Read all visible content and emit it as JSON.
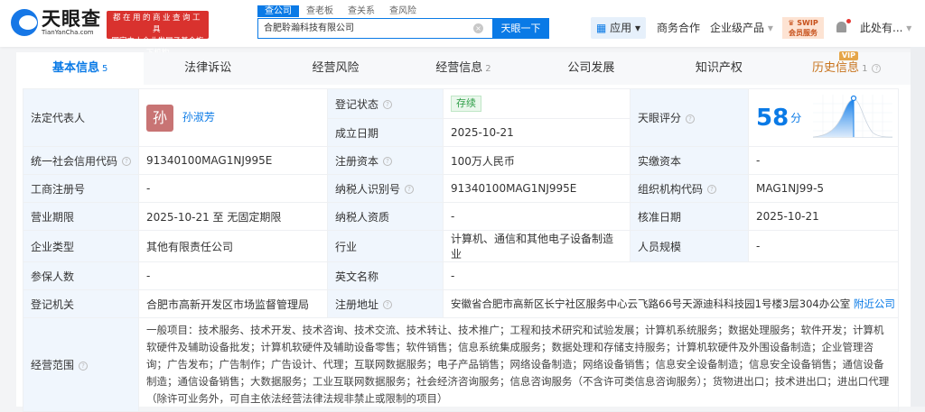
{
  "header": {
    "logo_cn": "天眼查",
    "logo_en": "TianYanCha.com",
    "slogan_line1": "都在用的商业查询工具",
    "slogan_line2": "国家中小企业发展子基金旗下机构",
    "search_tabs": [
      "查公司",
      "查老板",
      "查关系",
      "查风险"
    ],
    "search_value": "合肥聆瀚科技有限公司",
    "search_button": "天眼一下",
    "nav": {
      "apps": "应用",
      "business": "商务合作",
      "enterprise": "企业级产品",
      "swip_line1": "SWIP",
      "swip_line2": "会员服务",
      "user": "此处有..."
    }
  },
  "tabs": [
    {
      "label": "基本信息",
      "count": "5"
    },
    {
      "label": "法律诉讼"
    },
    {
      "label": "经营风险"
    },
    {
      "label": "经营信息",
      "count": "2"
    },
    {
      "label": "公司发展"
    },
    {
      "label": "知识产权"
    },
    {
      "label": "历史信息",
      "count": "1",
      "badge": "VIP"
    }
  ],
  "info": {
    "legal_rep_label": "法定代表人",
    "legal_rep_avatar": "孙",
    "legal_rep": "孙淑芳",
    "status_label": "登记状态",
    "status": "存续",
    "founded_label": "成立日期",
    "founded": "2025-10-21",
    "score_label": "天眼评分",
    "score": 58,
    "score_unit": "分",
    "credit_code_label": "统一社会信用代码",
    "credit_code": "91340100MAG1NJ995E",
    "reg_capital_label": "注册资本",
    "reg_capital": "100万人民币",
    "paid_capital_label": "实缴资本",
    "paid_capital": "-",
    "reg_no_label": "工商注册号",
    "reg_no": "-",
    "taxpayer_id_label": "纳税人识别号",
    "taxpayer_id": "91340100MAG1NJ995E",
    "org_code_label": "组织机构代码",
    "org_code": "MAG1NJ99-5",
    "term_label": "营业期限",
    "term": "2025-10-21 至 无固定期限",
    "taxpayer_qual_label": "纳税人资质",
    "taxpayer_qual": "-",
    "approval_label": "核准日期",
    "approval": "2025-10-21",
    "type_label": "企业类型",
    "type": "其他有限责任公司",
    "industry_label": "行业",
    "industry": "计算机、通信和其他电子设备制造业",
    "staff_label": "人员规模",
    "staff": "-",
    "insured_label": "参保人数",
    "insured": "-",
    "english_label": "英文名称",
    "english": "-",
    "authority_label": "登记机关",
    "authority": "合肥市高新开发区市场监督管理局",
    "address_label": "注册地址",
    "address": "安徽省合肥市高新区长宁社区服务中心云飞路66号天源迪科科技园1号楼3层304办公室",
    "nearby": "附近公司",
    "scope_label": "经营范围",
    "scope": "一般项目：技术服务、技术开发、技术咨询、技术交流、技术转让、技术推广；工程和技术研究和试验发展；计算机系统服务；数据处理服务；软件开发；计算机软硬件及辅助设备批发；计算机软硬件及辅助设备零售；软件销售；信息系统集成服务；数据处理和存储支持服务；计算机软硬件及外围设备制造；企业管理咨询；广告发布；广告制作；广告设计、代理；互联网数据服务；电子产品销售；网络设备制造；网络设备销售；信息安全设备制造；信息安全设备销售；通信设备制造；通信设备销售；大数据服务；工业互联网数据服务；社会经济咨询服务；信息咨询服务（不含许可类信息咨询服务）；货物进出口；技术进出口；进出口代理（除许可业务外，可自主依法经营法律法规非禁止或限制的项目）"
  },
  "colors": {
    "brand": "#0a7ae6",
    "history": "#c8741e",
    "status": "#2e9e47"
  }
}
